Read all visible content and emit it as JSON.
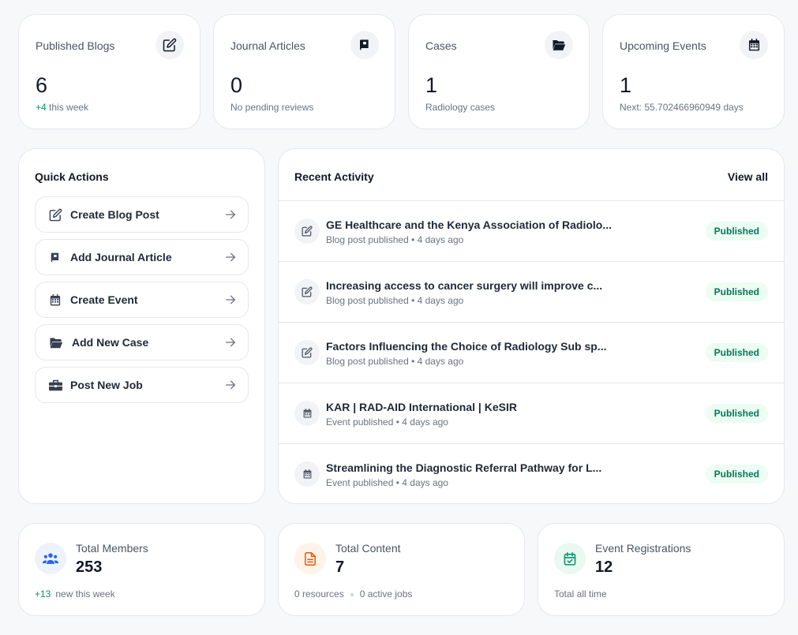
{
  "stats": [
    {
      "label": "Published Blogs",
      "value": "6",
      "sub_green": "+4",
      "sub_text": " this week",
      "icon": "pencil-square-icon"
    },
    {
      "label": "Journal Articles",
      "value": "0",
      "sub_text": "No pending reviews",
      "icon": "book-icon"
    },
    {
      "label": "Cases",
      "value": "1",
      "sub_text": "Radiology cases",
      "icon": "folder-open-icon"
    },
    {
      "label": "Upcoming Events",
      "value": "1",
      "sub_text": "Next: 55.702466960949 days",
      "icon": "calendar-icon"
    }
  ],
  "quick_actions": {
    "title": "Quick Actions",
    "items": [
      {
        "label": "Create Blog Post",
        "icon": "pencil-square-icon"
      },
      {
        "label": "Add Journal Article",
        "icon": "book-icon"
      },
      {
        "label": "Create Event",
        "icon": "calendar-icon"
      },
      {
        "label": "Add New Case",
        "icon": "folder-open-icon"
      },
      {
        "label": "Post New Job",
        "icon": "briefcase-icon"
      }
    ]
  },
  "recent_activity": {
    "title": "Recent Activity",
    "view_all": "View all",
    "items": [
      {
        "title": "GE Healthcare and the Kenya Association of Radiolo...",
        "sub": "Blog post published • 4 days ago",
        "status": "Published",
        "icon": "pencil-square-icon"
      },
      {
        "title": "Increasing access to cancer surgery will improve c...",
        "sub": "Blog post published • 4 days ago",
        "status": "Published",
        "icon": "pencil-square-icon"
      },
      {
        "title": "Factors Influencing the Choice of Radiology Sub sp...",
        "sub": "Blog post published • 4 days ago",
        "status": "Published",
        "icon": "pencil-square-icon"
      },
      {
        "title": "KAR | RAD-AID International | KeSIR",
        "sub": "Event published • 4 days ago",
        "status": "Published",
        "icon": "calendar-icon"
      },
      {
        "title": "Streamlining the Diagnostic Referral Pathway for L...",
        "sub": "Event published • 4 days ago",
        "status": "Published",
        "icon": "calendar-icon"
      }
    ]
  },
  "bottom": {
    "members": {
      "label": "Total Members",
      "value": "253",
      "foot_green": "+13",
      "foot_text": "new this week",
      "icon": "users-icon",
      "accent": "#2563eb",
      "bg": "#eef2ff"
    },
    "content": {
      "label": "Total Content",
      "value": "7",
      "foot_a": "0 resources",
      "foot_b": "0 active jobs",
      "icon": "document-icon",
      "accent": "#ea580c",
      "bg": "#fff3e8"
    },
    "registrations": {
      "label": "Event Registrations",
      "value": "12",
      "foot_text": "Total all time",
      "icon": "calendar-check-icon",
      "accent": "#059669",
      "bg": "#e9f8f1"
    }
  },
  "colors": {
    "published_badge_bg": "#ecfdf3",
    "published_badge_text": "#047857",
    "positive": "#059669"
  }
}
